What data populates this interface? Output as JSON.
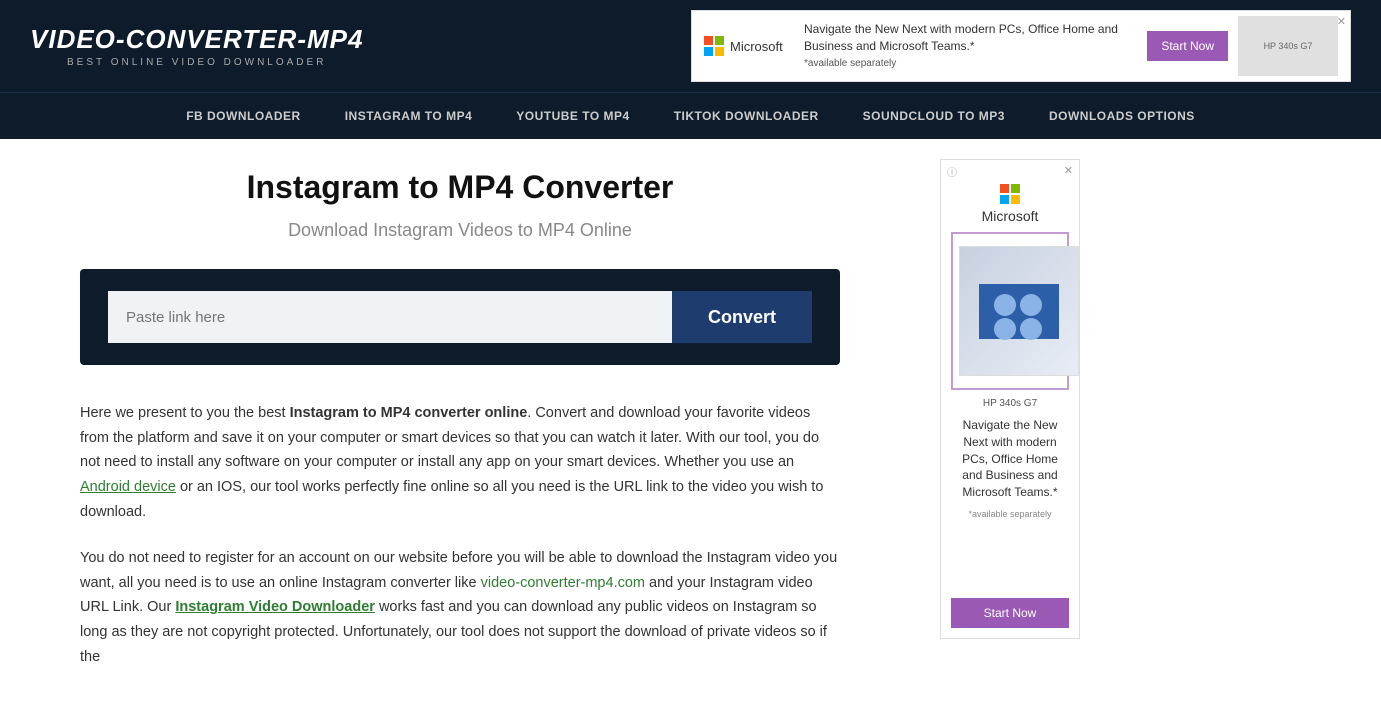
{
  "site": {
    "logo_title": "VIDEO-CONVERTER-MP4",
    "logo_subtitle": "BEST ONLINE VIDEO DOWNLOADER"
  },
  "nav": {
    "items": [
      {
        "label": "FB DOWNLOADER",
        "href": "#"
      },
      {
        "label": "INSTAGRAM TO MP4",
        "href": "#"
      },
      {
        "label": "YOUTUBE TO MP4",
        "href": "#"
      },
      {
        "label": "TIKTOK DOWNLOADER",
        "href": "#"
      },
      {
        "label": "SOUNDCLOUD TO MP3",
        "href": "#"
      },
      {
        "label": "DOWNLOADS OPTIONS",
        "href": "#"
      }
    ]
  },
  "header_ad": {
    "brand": "Microsoft",
    "text": "Navigate the New Next with modern PCs, Office Home and Business and Microsoft Teams.*",
    "fine_print": "*available separately",
    "cta": "Start Now",
    "model": "HP 340s G7"
  },
  "main": {
    "page_title": "Instagram to MP4 Converter",
    "page_subtitle": "Download Instagram Videos to MP4 Online",
    "input_placeholder": "Paste link here",
    "convert_button": "Convert",
    "body_text_1_pre": "Here we present to you the best ",
    "body_text_1_bold": "Instagram to MP4 converter online",
    "body_text_1_post": ". Convert and download your favorite videos from the platform and save it on your computer or smart devices so that you can watch it later. With our tool, you do not need to install any software on your computer or install any app on your smart devices. Whether you use an ",
    "body_text_1_link": "Android device",
    "body_text_1_post2": " or an IOS, our tool works perfectly fine online so all you need is the URL link to the video you wish to download.",
    "body_text_2_pre": "You do not need to register for an account on our website before you will be able to download the Instagram video you want, all you need is to use an online Instagram converter like ",
    "body_text_2_link1": "video-converter-mp4.com",
    "body_text_2_mid": " and your Instagram video URL Link. Our ",
    "body_text_2_link2": "Instagram Video Downloader",
    "body_text_2_post": " works fast and you can download any public videos on Instagram so long as they are not copyright protected. Unfortunately, our tool does not support the download of private videos so if the"
  },
  "sidebar_ad": {
    "brand": "Microsoft",
    "model": "HP 340s G7",
    "headline": "Navigate the New Next with modern PCs, Office Home and Business and Microsoft Teams.*",
    "fine_print": "*available separately",
    "cta": "Start Now"
  }
}
